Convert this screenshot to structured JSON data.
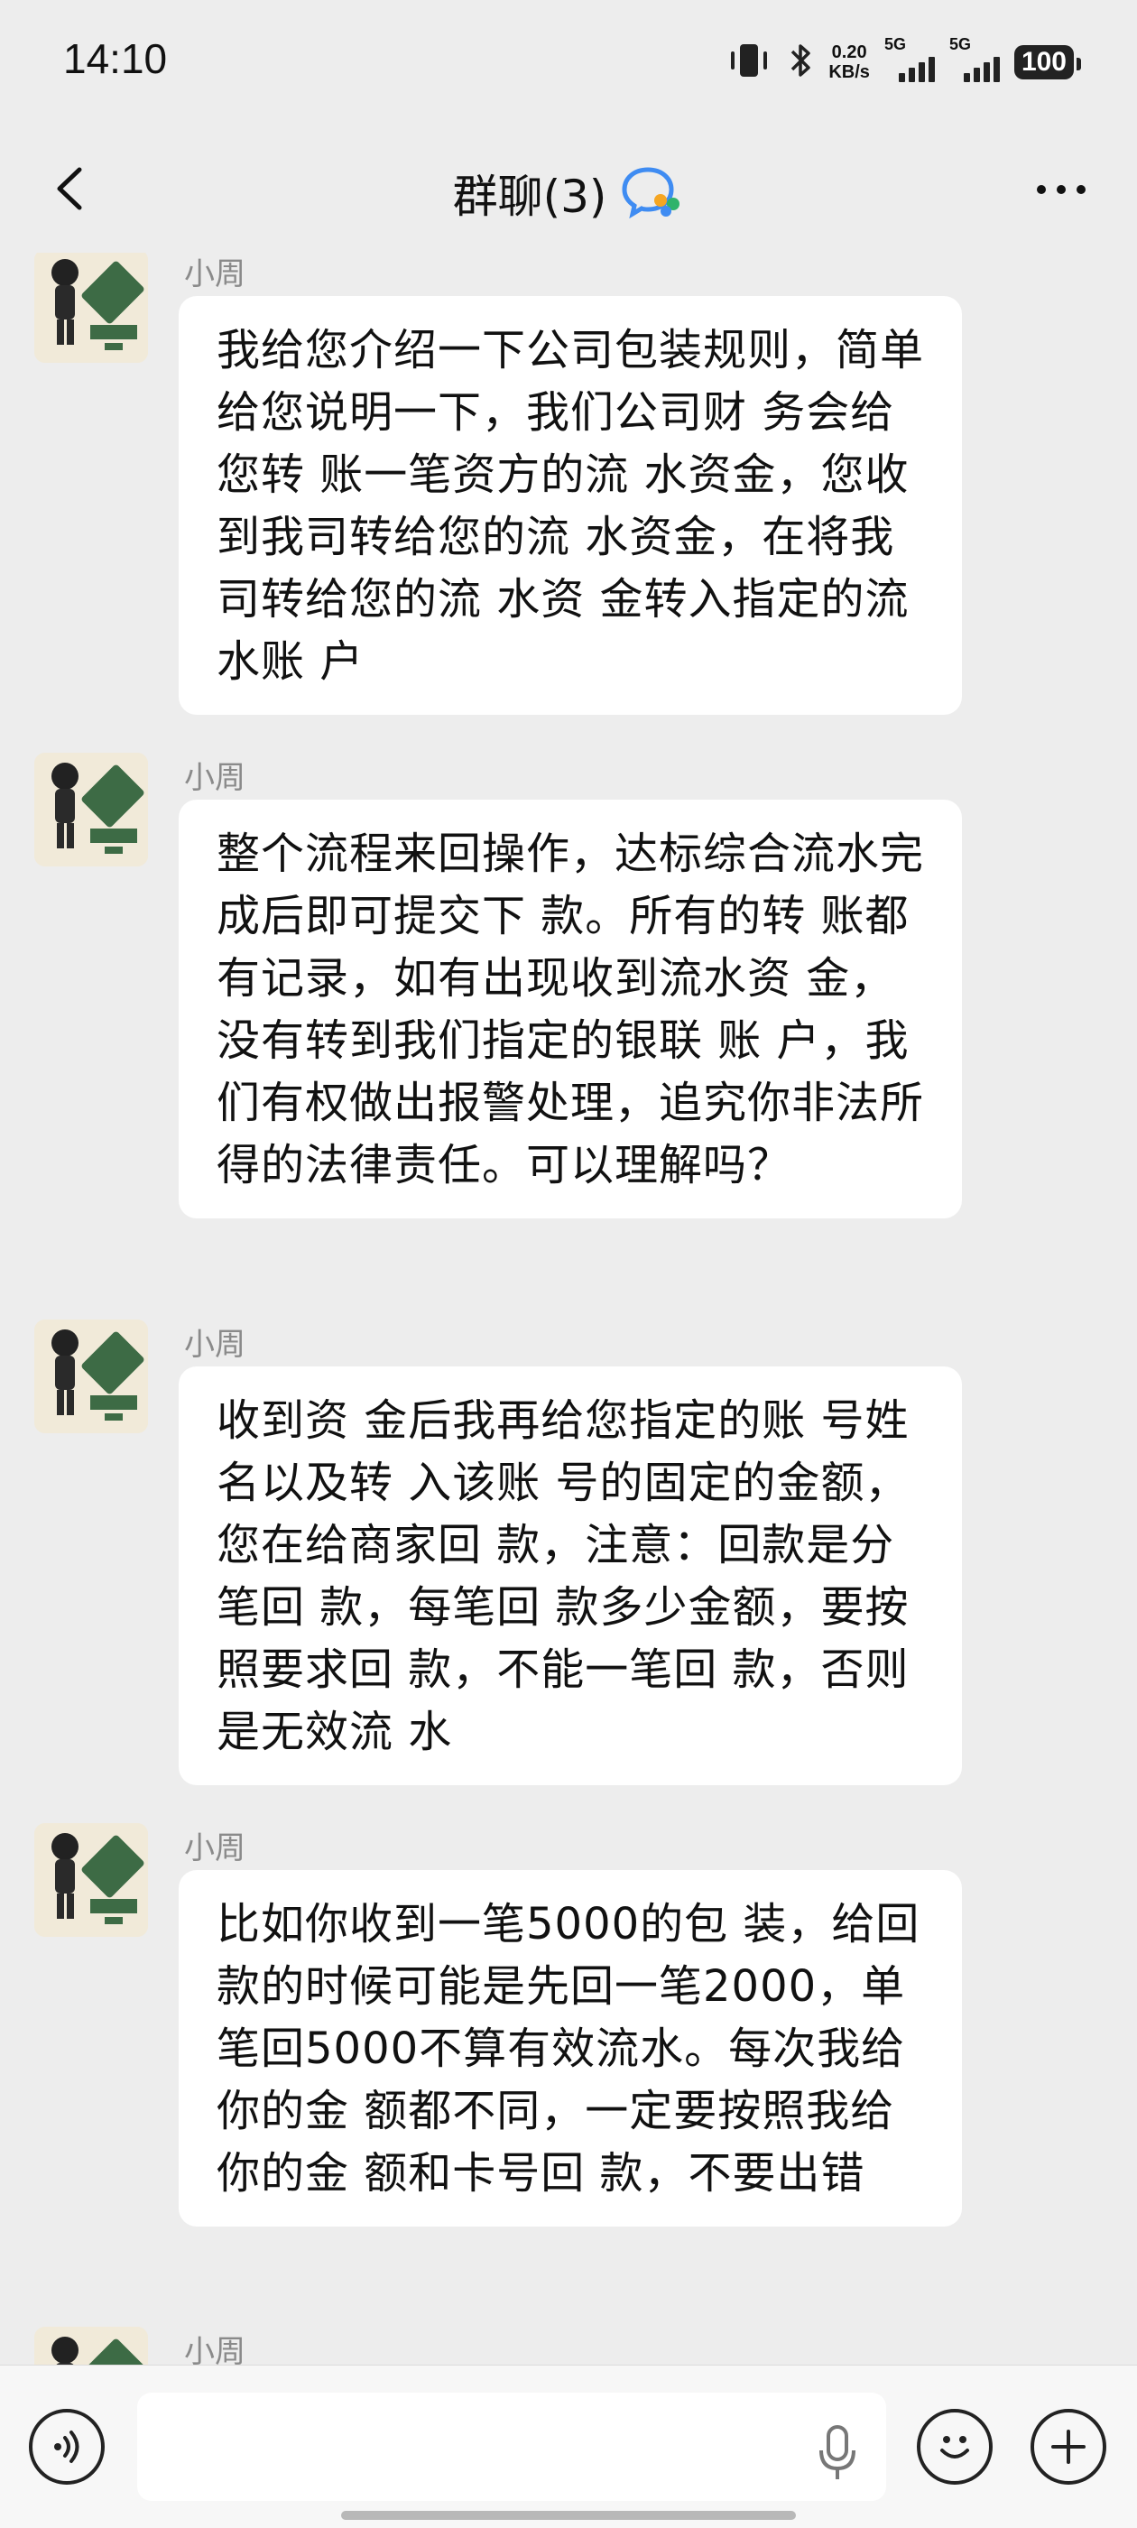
{
  "status_bar": {
    "time": "14:10",
    "net_speed_value": "0.20",
    "net_speed_unit": "KB/s",
    "sim1": "5G",
    "sim2": "5G",
    "battery": "100"
  },
  "nav": {
    "title": "群聊(3)",
    "back_icon": "chevron-left-icon",
    "group_icon": "group-chat-icon",
    "more_icon": "more-dots-icon"
  },
  "messages": [
    {
      "sender": "小周",
      "text": "我给您介绍一下公司包装规则，简单给您说明一下，我们公司财 务会给您转 账一笔资方的流 水资金，您收到我司转给您的流 水资金，在将我司转给您的流 水资 金转入指定的流 水账 户"
    },
    {
      "sender": "小周",
      "text": "整个流程来回操作，达标综合流水完成后即可提交下 款。所有的转 账都有记录，如有出现收到流水资 金，没有转到我们指定的银联 账 户，我们有权做出报警处理，追究你非法所得的法律责任。可以理解吗？"
    },
    {
      "sender": "小周",
      "text": "收到资 金后我再给您指定的账 号姓名以及转 入该账 号的固定的金额，您在给商家回 款，注意：回款是分笔回 款，每笔回 款多少金额，要按照要求回 款，不能一笔回 款，否则是无效流 水"
    },
    {
      "sender": "小周",
      "text": "比如你收到一笔5000的包 装，给回 款的时候可能是先回一笔2000，单笔回5000不算有效流水。每次我给你的金 额都不同，一定要按照我给你的金 额和卡号回 款，不要出错"
    },
    {
      "sender": "小周",
      "text": ""
    }
  ],
  "input_bar": {
    "voice_icon": "voice-toggle-icon",
    "placeholder": "",
    "mic_icon": "microphone-icon",
    "emoji_icon": "emoji-icon",
    "plus_icon": "plus-icon"
  },
  "colors": {
    "background": "#ededed",
    "bubble": "#ffffff",
    "accent_blue": "#3f8cf2",
    "accent_orange": "#f5a623",
    "accent_green": "#2fb36b"
  }
}
